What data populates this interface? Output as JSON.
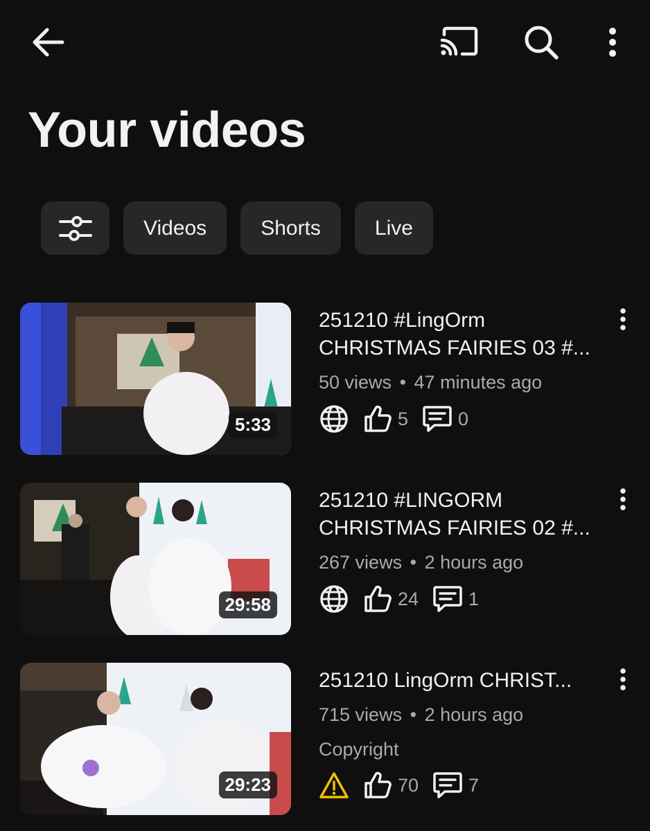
{
  "header": {
    "title": "Your videos",
    "icons": [
      "arrow-back-icon",
      "cast-icon",
      "search-icon",
      "more-vertical-icon"
    ]
  },
  "filters": {
    "icon": "filter-sliders-icon",
    "chips": [
      {
        "label": "Videos"
      },
      {
        "label": "Shorts"
      },
      {
        "label": "Live"
      }
    ]
  },
  "videos": [
    {
      "title_line1": "251210 #LingOrm",
      "title_line2": "CHRISTMAS FAIRIES 03 #...",
      "views": "50 views",
      "age": "47 minutes ago",
      "duration": "5:33",
      "visibility_icon": "globe-icon",
      "likes": "5",
      "comments": "0"
    },
    {
      "title_line1": "251210 #LINGORM",
      "title_line2": "CHRISTMAS FAIRIES 02 #...",
      "views": "267 views",
      "age": "2 hours ago",
      "duration": "29:58",
      "visibility_icon": "globe-icon",
      "likes": "24",
      "comments": "1"
    },
    {
      "title_line1": "251210 LingOrm CHRIST...",
      "views": "715 views",
      "age": "2 hours ago",
      "duration": "29:23",
      "restriction": "Copyright",
      "visibility_icon": "warning-icon",
      "warning_color": "#f2c200",
      "likes": "70",
      "comments": "7"
    }
  ],
  "dot": "•"
}
